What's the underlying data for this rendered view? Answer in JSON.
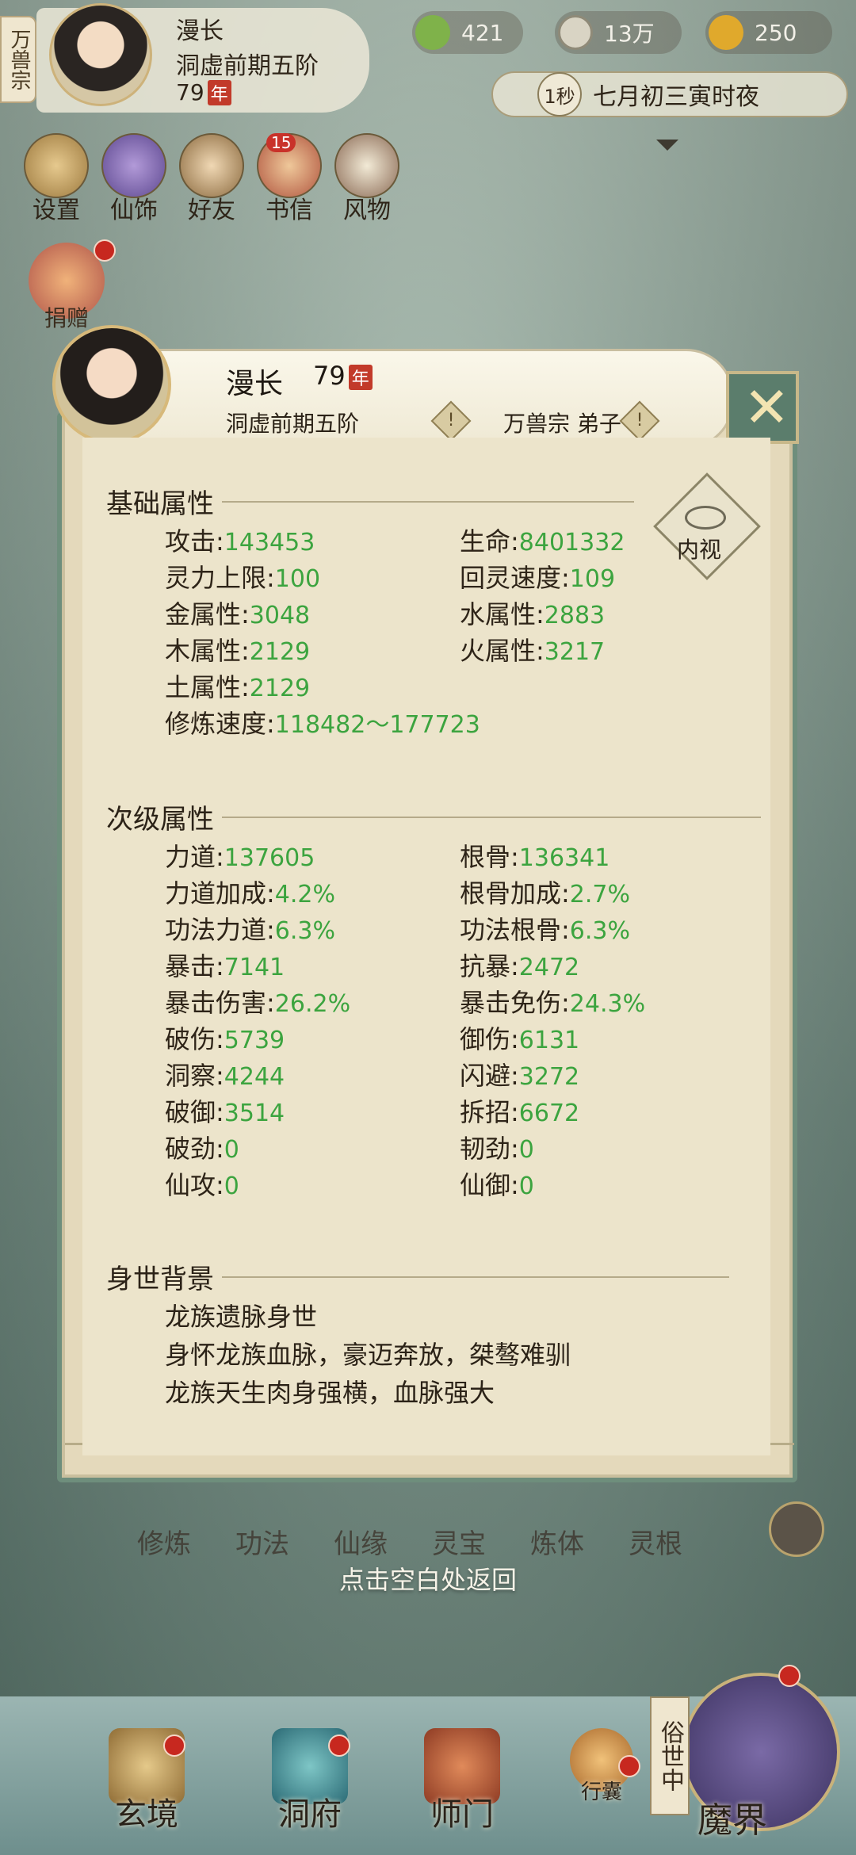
{
  "hud": {
    "sect_tag": "万兽宗",
    "player_name": "漫长",
    "player_realm": "洞虚前期五阶",
    "player_age": "79",
    "year_badge": "年",
    "resources": [
      {
        "icon": "spirit-stone-icon",
        "value": "421"
      },
      {
        "icon": "coin-icon",
        "value": "13万"
      },
      {
        "icon": "ingot-icon",
        "value": "250"
      }
    ],
    "time_speed": "1秒",
    "time_text": "七月初三寅时夜",
    "shortcuts": [
      {
        "label": "设置",
        "icon": "settings-icon"
      },
      {
        "label": "仙饰",
        "icon": "fairy-ornament-icon"
      },
      {
        "label": "好友",
        "icon": "friends-icon"
      },
      {
        "label": "书信",
        "icon": "letters-icon"
      },
      {
        "label": "风物",
        "icon": "scenery-icon"
      }
    ],
    "letters_badge": "15",
    "donate_label": "捐赠"
  },
  "profile": {
    "name": "漫长",
    "age": "79",
    "year_badge": "年",
    "realm": "洞虚前期五阶",
    "sect": "万兽宗 弟子",
    "info_icon": "!",
    "close_icon": "close-icon",
    "inner_view": "内视"
  },
  "basic": {
    "title": "基础属性",
    "attrs": [
      {
        "label": "攻击",
        "value": "143453"
      },
      {
        "label": "生命",
        "value": "8401332"
      },
      {
        "label": "灵力上限",
        "value": "100"
      },
      {
        "label": "回灵速度",
        "value": "109"
      },
      {
        "label": "金属性",
        "value": "3048"
      },
      {
        "label": "水属性",
        "value": "2883"
      },
      {
        "label": "木属性",
        "value": "2129"
      },
      {
        "label": "火属性",
        "value": "3217"
      },
      {
        "label": "土属性",
        "value": "2129"
      },
      {
        "label": "修炼速度",
        "value": "118482～177723"
      }
    ]
  },
  "secondary": {
    "title": "次级属性",
    "attrs": [
      {
        "label": "力道",
        "value": "137605"
      },
      {
        "label": "根骨",
        "value": "136341"
      },
      {
        "label": "力道加成",
        "value": "4.2%"
      },
      {
        "label": "根骨加成",
        "value": "2.7%"
      },
      {
        "label": "功法力道",
        "value": "6.3%"
      },
      {
        "label": "功法根骨",
        "value": "6.3%"
      },
      {
        "label": "暴击",
        "value": "7141"
      },
      {
        "label": "抗暴",
        "value": "2472"
      },
      {
        "label": "暴击伤害",
        "value": "26.2%"
      },
      {
        "label": "暴击免伤",
        "value": "24.3%"
      },
      {
        "label": "破伤",
        "value": "5739"
      },
      {
        "label": "御伤",
        "value": "6131"
      },
      {
        "label": "洞察",
        "value": "4244"
      },
      {
        "label": "闪避",
        "value": "3272"
      },
      {
        "label": "破御",
        "value": "3514"
      },
      {
        "label": "拆招",
        "value": "6672"
      },
      {
        "label": "破劲",
        "value": "0"
      },
      {
        "label": "韧劲",
        "value": "0"
      },
      {
        "label": "仙攻",
        "value": "0"
      },
      {
        "label": "仙御",
        "value": "0"
      }
    ]
  },
  "background": {
    "title": "身世背景",
    "lines": [
      "龙族遗脉身世",
      "身怀龙族血脉，豪迈奔放，桀骜难驯",
      "龙族天生肉身强横，血脉强大"
    ]
  },
  "return_hint": "点击空白处返回",
  "func_row": [
    "修炼",
    "功法",
    "仙缘",
    "灵宝",
    "炼体",
    "灵根"
  ],
  "bottom_nav": [
    {
      "label": "玄境",
      "icon": "realm-icon"
    },
    {
      "label": "洞府",
      "icon": "cave-icon"
    },
    {
      "label": "师门",
      "icon": "sect-icon"
    },
    {
      "label": "行囊",
      "icon": "bag-icon"
    }
  ],
  "world_tag": "俗世中",
  "world_label": "魔界"
}
